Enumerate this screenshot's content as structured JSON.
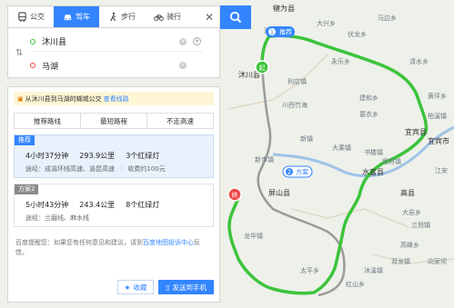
{
  "modes": [
    {
      "label": "公交",
      "icon": "bus-icon"
    },
    {
      "label": "驾车",
      "icon": "car-icon"
    },
    {
      "label": "步行",
      "icon": "walk-icon"
    },
    {
      "label": "骑行",
      "icon": "bike-icon"
    }
  ],
  "close_label": "✕",
  "inputs": {
    "start": "沐川县",
    "end": "马湖"
  },
  "notice": {
    "text": "从沐川县到马湖的蝴城公交",
    "link": "查看线路"
  },
  "tabs": [
    "推荐路线",
    "最短路程",
    "不走高速"
  ],
  "routes": [
    {
      "badge": "推荐",
      "time": "4小时37分钟",
      "distance": "293.9公里",
      "lights": "3个红绿灯",
      "via_label": "途经：",
      "via": "成渝环线高速、渝昆高速",
      "toll": "收费约100元"
    },
    {
      "badge": "方案2",
      "time": "5小时43分钟",
      "distance": "243.4公里",
      "lights": "8个红绿灯",
      "via_label": "途经：",
      "via": "兰磨线、麻水线",
      "toll": ""
    }
  ],
  "tip": {
    "text": "百度提醒您：如果您有任何意见和建议，请到",
    "link": "百度地图投诉中心",
    "tail": "反馈。"
  },
  "actions": {
    "collect": "收藏",
    "send": "发送到手机"
  },
  "map": {
    "route_colors": {
      "main": "#3bc43b",
      "alt": "#9a9a9a",
      "river": "#9fc3e8"
    },
    "marker_start": "起",
    "marker_end": "终",
    "label_recommend": "推荐",
    "label_plan2": "方案",
    "num1": "1",
    "num2": "2",
    "places": [
      "犍为县",
      "大兴乡",
      "双溪乡",
      "马边乡",
      "伏龙乡",
      "沐川县",
      "利店镇",
      "川西竹海",
      "建和乡",
      "屏山县",
      "新镇",
      "大乘镇",
      "书楼镇",
      "叙府镇",
      "宜宾市",
      "水富县",
      "高县",
      "龙华镇",
      "太平乡",
      "兰旭镇",
      "高峰乡",
      "江安",
      "大岩乡",
      "沐溪镇",
      "永乐乡",
      "清水乡",
      "黄坪乡",
      "蓑衣乡",
      "新市镇",
      "向家坝",
      "双龙镇",
      "红山乡",
      "宜宾县",
      "柏溪镇"
    ]
  }
}
